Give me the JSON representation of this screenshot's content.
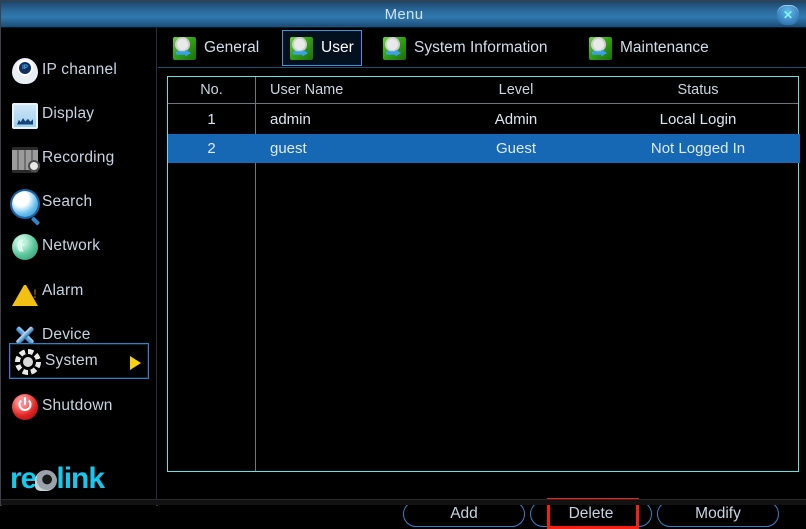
{
  "window": {
    "title": "Menu",
    "close_label": "✕"
  },
  "sidebar": {
    "items": [
      {
        "label": "IP channel",
        "icon": "camera-icon",
        "selected": false
      },
      {
        "label": "Display",
        "icon": "monitor-icon",
        "selected": false
      },
      {
        "label": "Recording",
        "icon": "recording-icon",
        "selected": false
      },
      {
        "label": "Search",
        "icon": "search-icon",
        "selected": false
      },
      {
        "label": "Network",
        "icon": "network-icon",
        "selected": false
      },
      {
        "label": "Alarm",
        "icon": "warning-icon",
        "selected": false
      },
      {
        "label": "Device",
        "icon": "tools-icon",
        "selected": false
      },
      {
        "label": "System",
        "icon": "gear-icon",
        "selected": true
      },
      {
        "label": "Shutdown",
        "icon": "power-icon",
        "selected": false
      }
    ],
    "logo": {
      "before": "re",
      "lens": "o",
      "after": "link"
    }
  },
  "tabs": [
    {
      "label": "General",
      "active": false
    },
    {
      "label": "User",
      "active": true
    },
    {
      "label": "System Information",
      "active": false
    },
    {
      "label": "Maintenance",
      "active": false
    }
  ],
  "table": {
    "columns": [
      "No.",
      "User Name",
      "Level",
      "Status"
    ],
    "rows": [
      {
        "no": "1",
        "user_name": "admin",
        "level": "Admin",
        "status": "Local Login",
        "selected": false
      },
      {
        "no": "2",
        "user_name": "guest",
        "level": "Guest",
        "status": "Not Logged In",
        "selected": true
      }
    ]
  },
  "buttons": {
    "add": "Add",
    "delete": "Delete",
    "modify": "Modify"
  },
  "colors": {
    "accent_blue": "#2f86cc",
    "selection_blue": "#1668b4",
    "table_border": "#5fe4e6",
    "highlight_red": "#f71e12",
    "logo_cyan": "#15c8f0",
    "arrow_yellow": "#f7d312"
  }
}
